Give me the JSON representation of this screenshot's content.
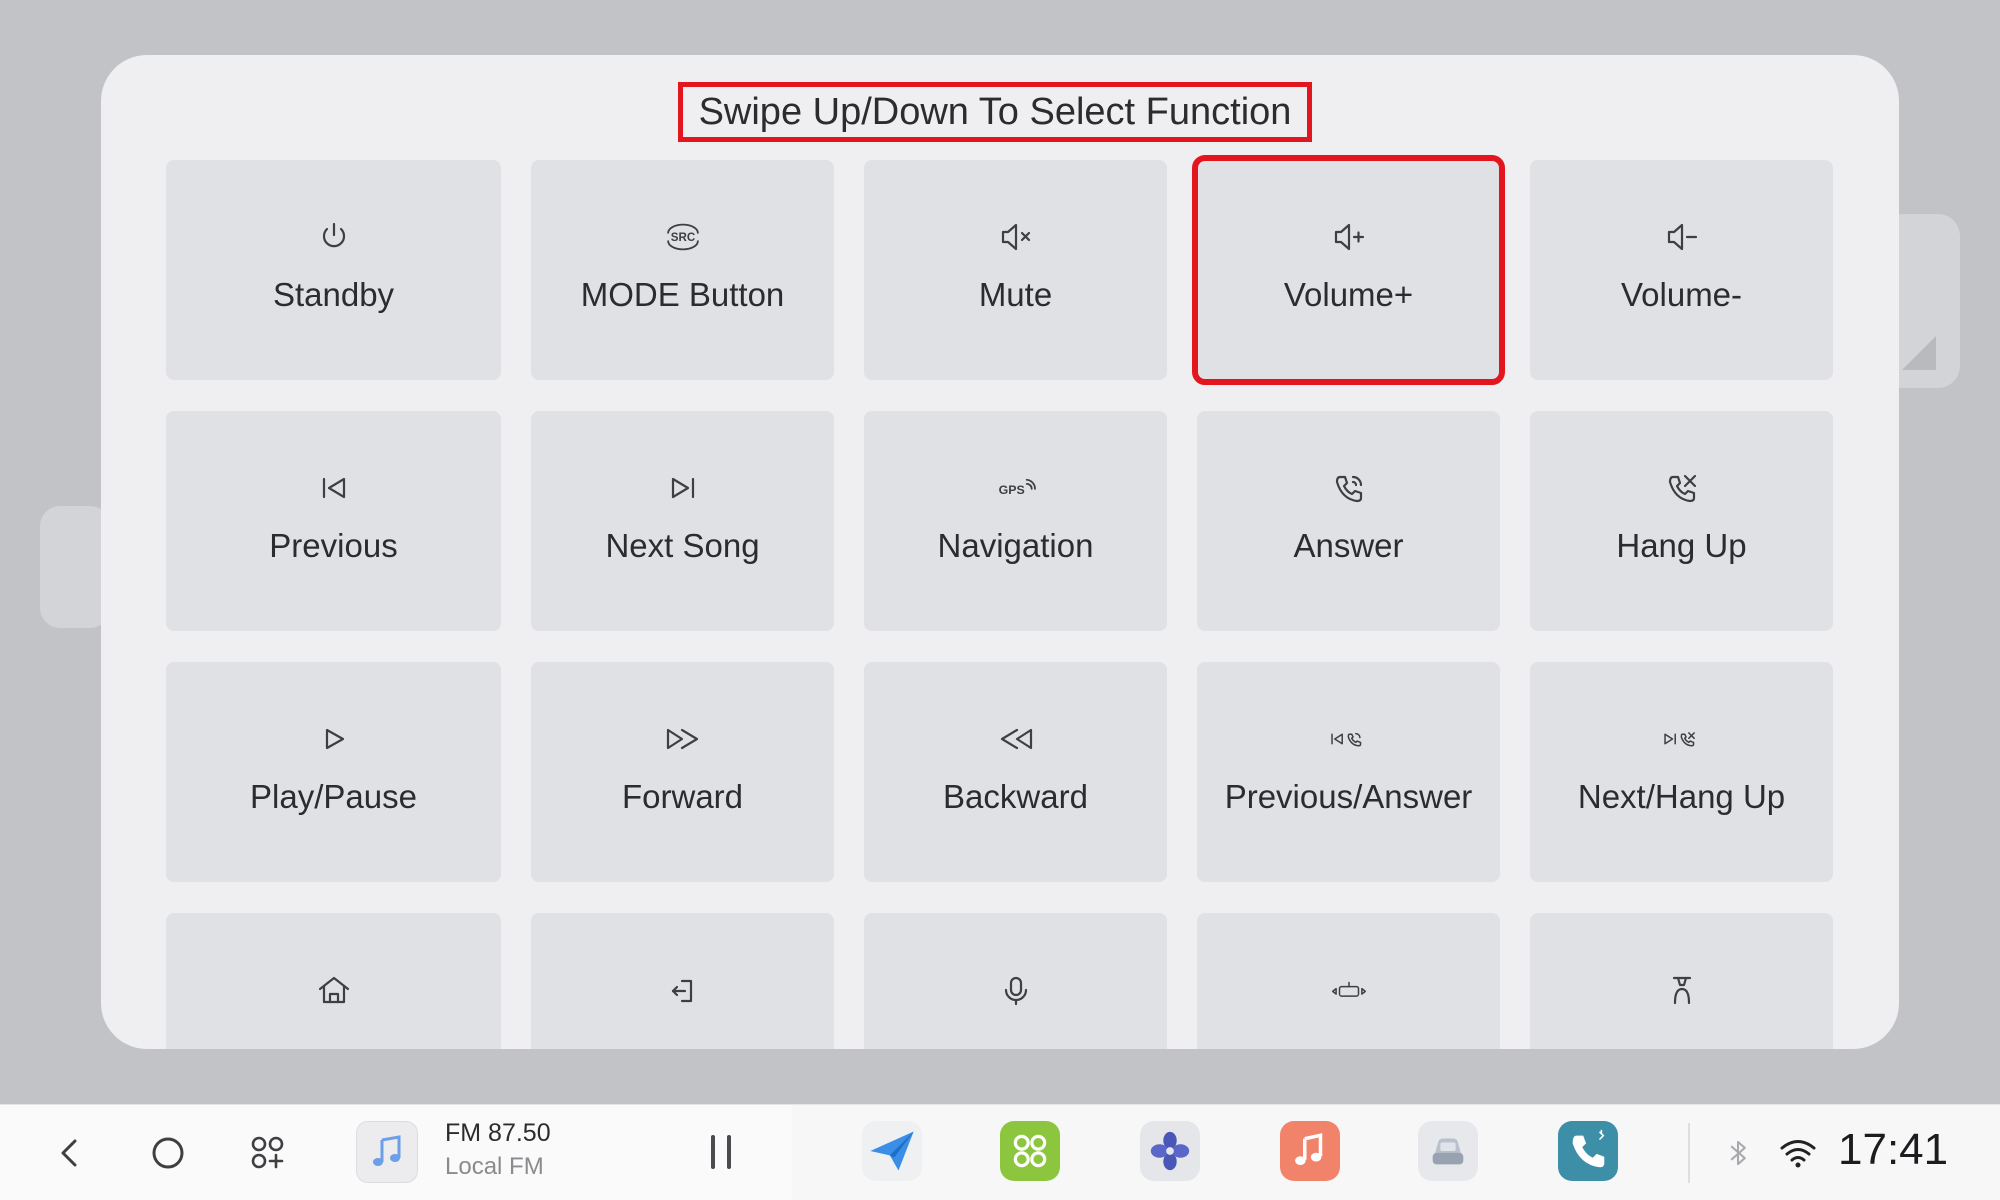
{
  "dialog": {
    "title": "Swipe Up/Down To Select Function"
  },
  "tiles": [
    {
      "label": "Standby",
      "icon": "power-icon"
    },
    {
      "label": "MODE Button",
      "icon": "src-icon",
      "icon_text": "SRC"
    },
    {
      "label": "Mute",
      "icon": "mute-icon"
    },
    {
      "label": "Volume+",
      "icon": "volume-up-icon",
      "selected": true
    },
    {
      "label": "Volume-",
      "icon": "volume-down-icon"
    },
    {
      "label": "Previous",
      "icon": "previous-icon"
    },
    {
      "label": "Next Song",
      "icon": "next-song-icon"
    },
    {
      "label": "Navigation",
      "icon": "gps-icon",
      "icon_text": "GPS"
    },
    {
      "label": "Answer",
      "icon": "answer-call-icon"
    },
    {
      "label": "Hang Up",
      "icon": "hang-up-icon"
    },
    {
      "label": "Play/Pause",
      "icon": "play-icon"
    },
    {
      "label": "Forward",
      "icon": "fast-forward-icon"
    },
    {
      "label": "Backward",
      "icon": "rewind-icon"
    },
    {
      "label": "Previous/Answer",
      "icon": "previous-answer-icon"
    },
    {
      "label": "Next/Hang Up",
      "icon": "next-hangup-icon"
    },
    {
      "label": "",
      "icon": "home-icon"
    },
    {
      "label": "",
      "icon": "return-icon"
    },
    {
      "label": "",
      "icon": "microphone-icon"
    },
    {
      "label": "",
      "icon": "camera-360-icon"
    },
    {
      "label": "",
      "icon": "seat-icon"
    }
  ],
  "taskbar": {
    "media": {
      "title": "FM 87.50",
      "subtitle": "Local FM"
    },
    "clock": "17:41"
  },
  "colors": {
    "highlight": "#e3161f",
    "tile_bg": "#e0e1e4",
    "dialog_bg": "#efeff1"
  }
}
